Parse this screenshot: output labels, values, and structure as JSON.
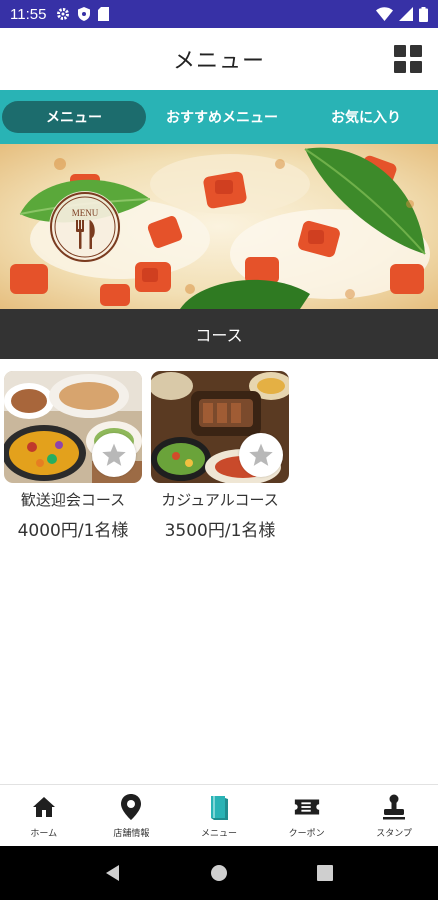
{
  "status_bar": {
    "time": "11:55"
  },
  "header": {
    "title": "メニュー"
  },
  "tabs": [
    {
      "label": "メニュー",
      "active": true
    },
    {
      "label": "おすすめメニュー",
      "active": false
    },
    {
      "label": "お気に入り",
      "active": false
    }
  ],
  "hero": {
    "badge_text": "MENU"
  },
  "section": {
    "title": "コース"
  },
  "courses": [
    {
      "name": "歓送迎会コース",
      "price": "4000円/1名様"
    },
    {
      "name": "カジュアルコース",
      "price": "3500円/1名様"
    }
  ],
  "bottom_nav": [
    {
      "label": "ホーム",
      "icon": "home-icon"
    },
    {
      "label": "店舗情報",
      "icon": "location-pin-icon"
    },
    {
      "label": "メニュー",
      "icon": "book-icon",
      "active": true
    },
    {
      "label": "クーポン",
      "icon": "ticket-icon"
    },
    {
      "label": "スタンプ",
      "icon": "stamp-icon"
    }
  ],
  "colors": {
    "status_bar": "#3731a6",
    "tab_bar": "#29b3b5",
    "tab_active": "#1c6c6d",
    "section_bar": "#333333",
    "nav_active": "#29b3b5"
  }
}
